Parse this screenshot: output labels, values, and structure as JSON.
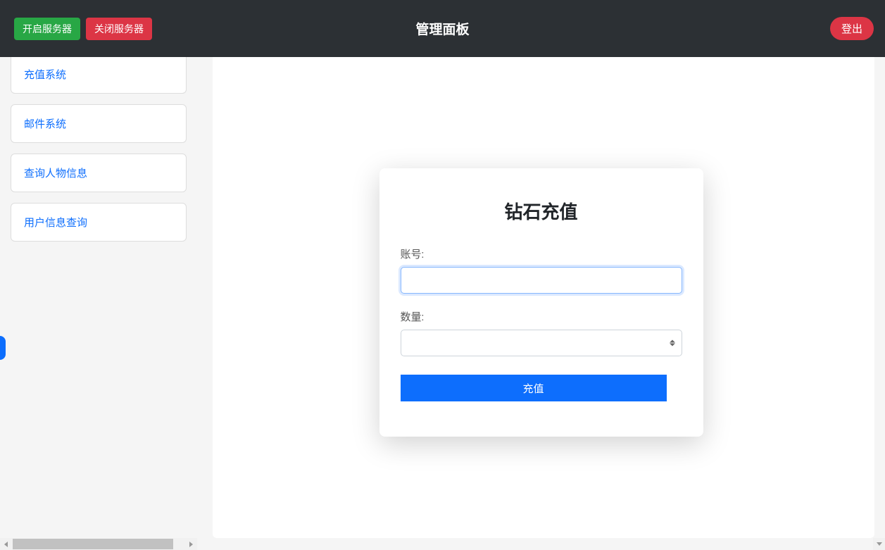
{
  "header": {
    "start_server_label": "开启服务器",
    "stop_server_label": "关闭服务器",
    "title": "管理面板",
    "logout_label": "登出"
  },
  "sidebar": {
    "items": [
      {
        "label": "充值系统"
      },
      {
        "label": "邮件系统"
      },
      {
        "label": "查询人物信息"
      },
      {
        "label": "用户信息查询"
      }
    ]
  },
  "modal": {
    "title": "钻石充值",
    "account_label": "账号:",
    "account_value": "",
    "quantity_label": "数量:",
    "quantity_value": "",
    "submit_label": "充值"
  }
}
